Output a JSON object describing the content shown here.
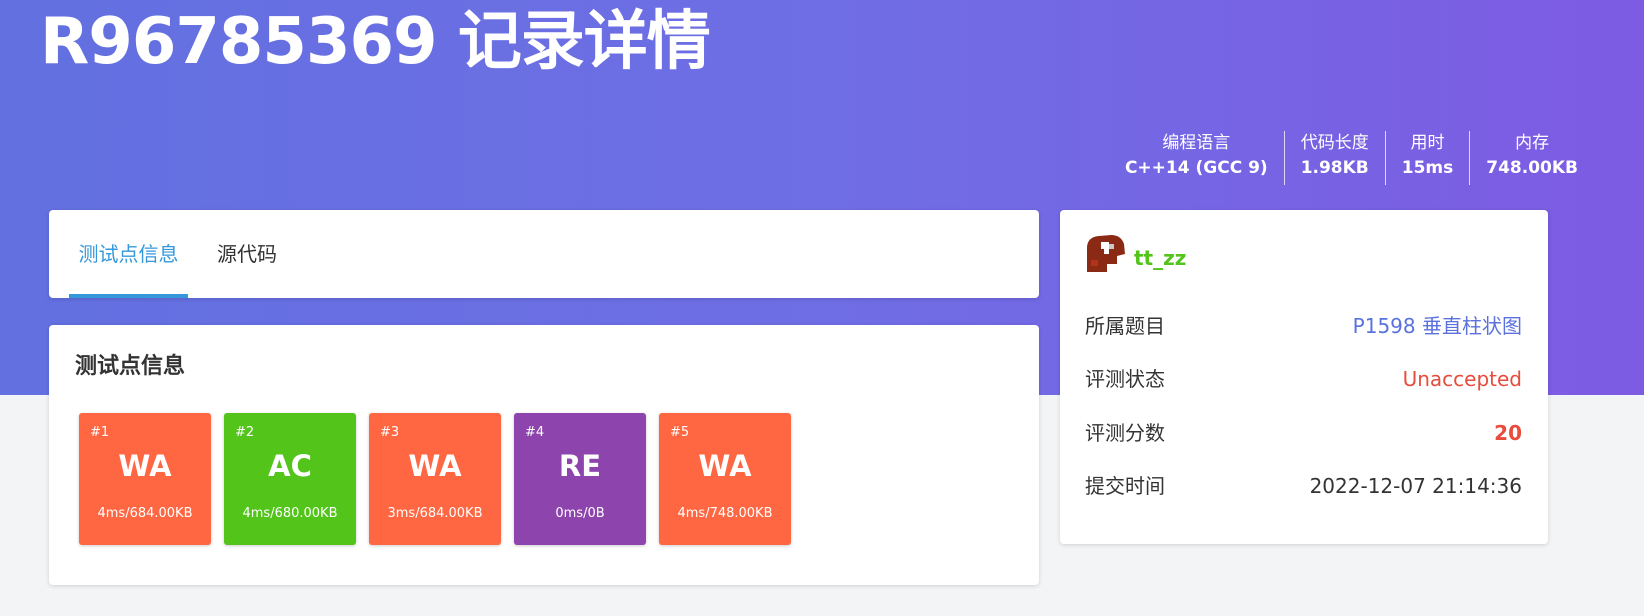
{
  "header": {
    "title": "R96785369 记录详情",
    "stats": [
      {
        "label": "编程语言",
        "value": "C++14 (GCC 9)"
      },
      {
        "label": "代码长度",
        "value": "1.98KB"
      },
      {
        "label": "用时",
        "value": "15ms"
      },
      {
        "label": "内存",
        "value": "748.00KB"
      }
    ]
  },
  "tabs": {
    "tests": "测试点信息",
    "source": "源代码",
    "active": "tests"
  },
  "tests": {
    "title": "测试点信息",
    "cases": [
      {
        "num": "#1",
        "status": "WA",
        "resource": "4ms/684.00KB",
        "color": "#ff6743"
      },
      {
        "num": "#2",
        "status": "AC",
        "resource": "4ms/680.00KB",
        "color": "#52c41a"
      },
      {
        "num": "#3",
        "status": "WA",
        "resource": "3ms/684.00KB",
        "color": "#ff6743"
      },
      {
        "num": "#4",
        "status": "RE",
        "resource": "0ms/0B",
        "color": "#8e44ad"
      },
      {
        "num": "#5",
        "status": "WA",
        "resource": "4ms/748.00KB",
        "color": "#ff6743"
      }
    ]
  },
  "info": {
    "username": "tt_zz",
    "username_color": "#52c41a",
    "avatar_icon": "user-avatar-icon",
    "problem_label": "所属题目",
    "problem_value": "P1598 垂直柱状图",
    "status_label": "评测状态",
    "status_value": "Unaccepted",
    "score_label": "评测分数",
    "score_value": "20",
    "time_label": "提交时间",
    "time_value": "2022-12-07 21:14:36"
  },
  "colors": {
    "accent": "#3498db",
    "header_gradient_start": "#6270e0",
    "header_gradient_end": "#7d5be3",
    "link": "#5b72de",
    "error": "#e74c3c"
  }
}
